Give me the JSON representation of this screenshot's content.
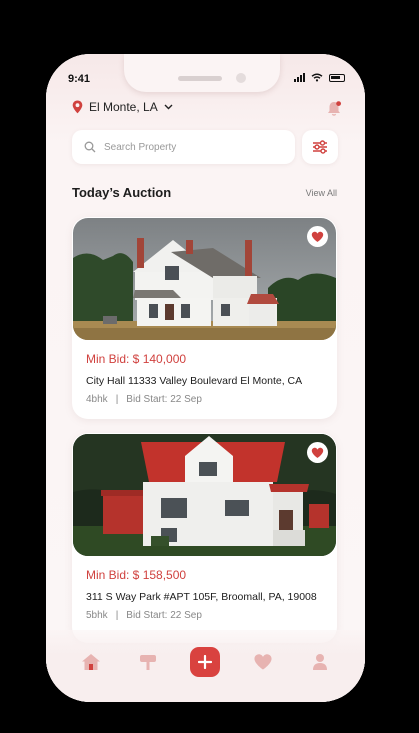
{
  "status_bar": {
    "time": "9:41"
  },
  "location": {
    "label": "El Monte, LA"
  },
  "search": {
    "placeholder": "Search Property"
  },
  "section": {
    "title": "Today’s Auction",
    "view_all": "View All"
  },
  "listings": [
    {
      "min_bid": "Min Bid: $ 140,000",
      "address": "City Hall 11333 Valley Boulevard El Monte, CA",
      "size": "4bhk",
      "separator": "|",
      "bid_start": "Bid Start: 22 Sep",
      "favorited": true
    },
    {
      "min_bid": "Min Bid: $ 158,500",
      "address": "311 S Way Park #APT 105F, Broomall, PA, 19008",
      "size": "5bhk",
      "separator": "|",
      "bid_start": "Bid Start: 22 Sep",
      "favorited": true
    }
  ],
  "bottom_nav": {
    "items": [
      {
        "icon": "home-icon",
        "active": true
      },
      {
        "icon": "signpost-icon",
        "active": false
      },
      {
        "icon": "plus-icon",
        "active": false
      },
      {
        "icon": "heart-icon",
        "active": false
      },
      {
        "icon": "user-icon",
        "active": false
      }
    ]
  },
  "colors": {
    "accent": "#d9423f",
    "heart": "#d0413e",
    "background": "#fbf4f4"
  }
}
